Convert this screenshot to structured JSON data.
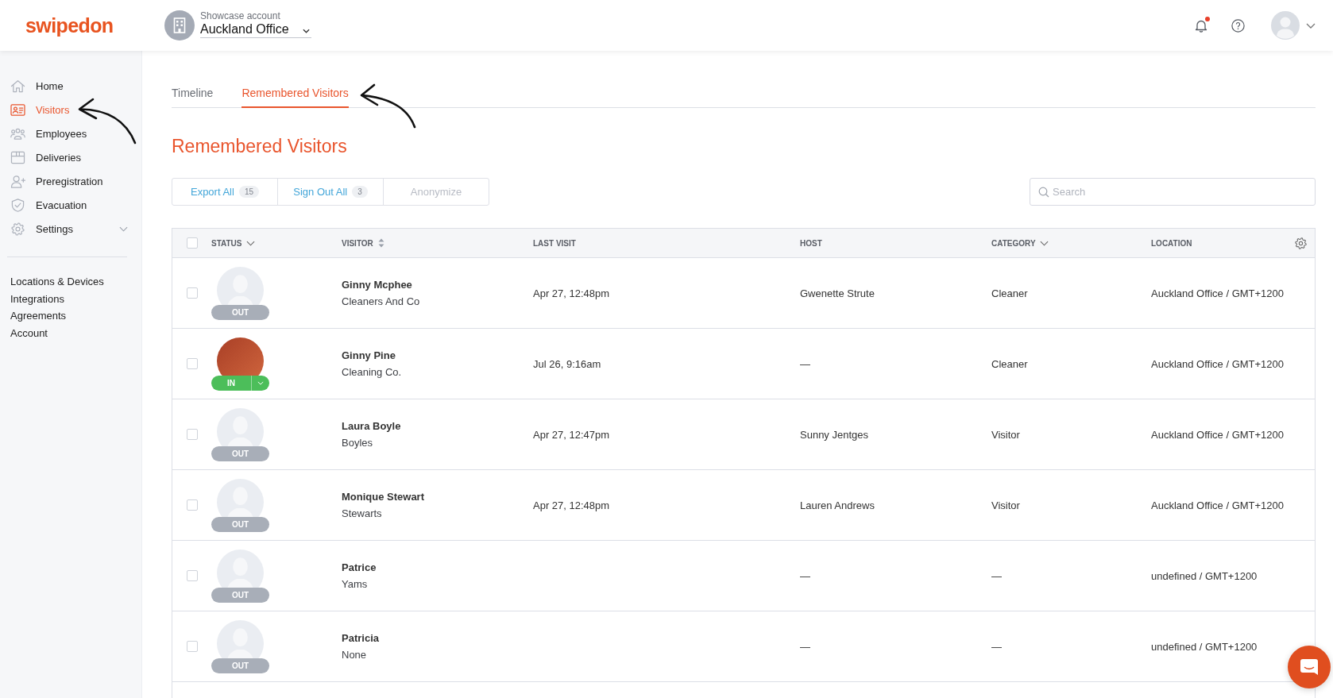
{
  "header": {
    "logo": "swipedon",
    "account": {
      "label": "Showcase account",
      "name": "Auckland Office"
    },
    "notifications": {
      "unread": true
    }
  },
  "sidebar": {
    "items": [
      {
        "label": "Home",
        "selected": false
      },
      {
        "label": "Visitors",
        "selected": true
      },
      {
        "label": "Employees",
        "selected": false
      },
      {
        "label": "Deliveries",
        "selected": false
      },
      {
        "label": "Preregistration",
        "selected": false
      },
      {
        "label": "Evacuation",
        "selected": false
      },
      {
        "label": "Settings",
        "selected": false,
        "expanded": false
      }
    ],
    "links": [
      "Locations & Devices",
      "Integrations",
      "Agreements",
      "Account"
    ]
  },
  "tabs": [
    {
      "label": "Timeline",
      "selected": false
    },
    {
      "label": "Remembered Visitors",
      "selected": true
    }
  ],
  "page_title": "Remembered Visitors",
  "toolbar": {
    "actions": [
      {
        "label": "Export All",
        "count": "15",
        "disabled": false
      },
      {
        "label": "Sign Out All",
        "count": "3",
        "disabled": false
      },
      {
        "label": "Anonymize",
        "disabled": true
      }
    ],
    "search": {
      "placeholder": "Search"
    }
  },
  "table": {
    "all_selected": false,
    "columns": [
      {
        "label": "STATUS",
        "kind": "filter"
      },
      {
        "label": "VISITOR",
        "kind": "sort"
      },
      {
        "label": "LAST VISIT",
        "kind": "plain"
      },
      {
        "label": "HOST",
        "kind": "plain"
      },
      {
        "label": "CATEGORY",
        "kind": "filter"
      },
      {
        "label": "LOCATION",
        "kind": "plain"
      }
    ],
    "rows": [
      {
        "selected": false,
        "status": "OUT",
        "signed_in": false,
        "has_photo": false,
        "name": "Ginny Mcphee",
        "company": "Cleaners And Co",
        "last_visit": "Apr 27, 12:48pm",
        "host": "Gwenette Strute",
        "category": "Cleaner",
        "location": "Auckland Office / GMT+1200"
      },
      {
        "selected": false,
        "status": "IN",
        "signed_in": true,
        "has_photo": true,
        "name": "Ginny Pine",
        "company": "Cleaning Co.",
        "last_visit": "Jul 26, 9:16am",
        "host": "—",
        "category": "Cleaner",
        "location": "Auckland Office / GMT+1200"
      },
      {
        "selected": false,
        "status": "OUT",
        "signed_in": false,
        "has_photo": false,
        "name": "Laura Boyle",
        "company": "Boyles",
        "last_visit": "Apr 27, 12:47pm",
        "host": "Sunny Jentges",
        "category": "Visitor",
        "location": "Auckland Office / GMT+1200"
      },
      {
        "selected": false,
        "status": "OUT",
        "signed_in": false,
        "has_photo": false,
        "name": "Monique Stewart",
        "company": "Stewarts",
        "last_visit": "Apr 27, 12:48pm",
        "host": "Lauren Andrews",
        "category": "Visitor",
        "location": "Auckland Office / GMT+1200"
      },
      {
        "selected": false,
        "status": "OUT",
        "signed_in": false,
        "has_photo": false,
        "name": "Patrice",
        "company": "Yams",
        "host": "—",
        "category": "—",
        "location": "undefined / GMT+1200"
      },
      {
        "selected": false,
        "status": "OUT",
        "signed_in": false,
        "has_photo": false,
        "name": "Patricia",
        "company": "None",
        "host": "—",
        "category": "—",
        "location": "undefined / GMT+1200"
      }
    ]
  }
}
